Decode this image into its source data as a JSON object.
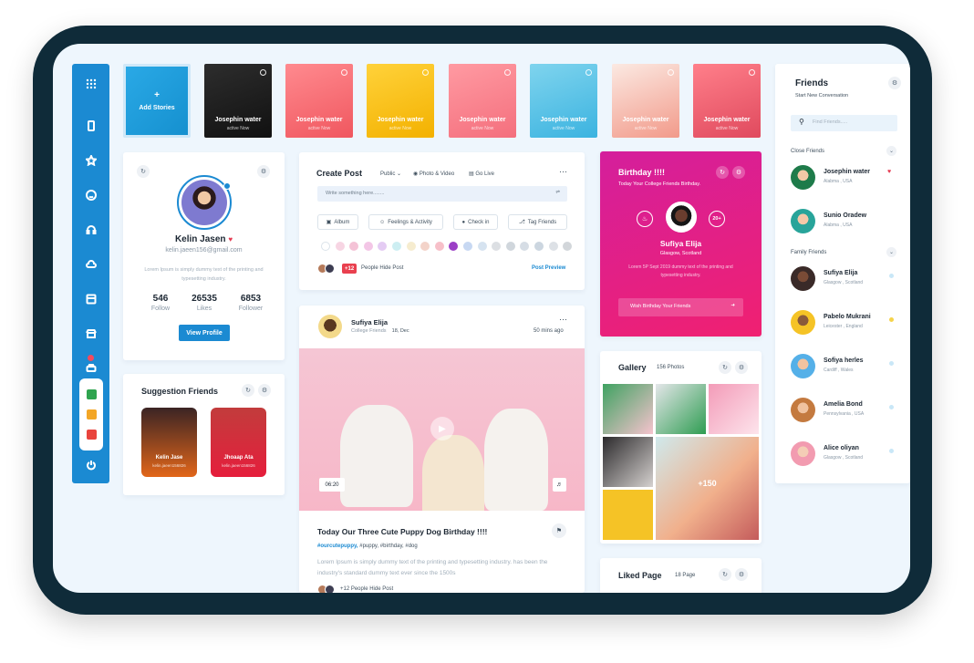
{
  "stories": [
    {
      "label": "Add Stories",
      "sub": "",
      "add": true
    },
    {
      "label": "Josephin water",
      "sub": "active Now",
      "bg": "linear-gradient(160deg,#2d2d2d,#111)"
    },
    {
      "label": "Josephin water",
      "sub": "active Now",
      "bg": "linear-gradient(160deg,#ff8a8f,#f0575f)"
    },
    {
      "label": "Josephin water",
      "sub": "active Now",
      "bg": "linear-gradient(160deg,#ffd23a,#f3b100)"
    },
    {
      "label": "Josephin water",
      "sub": "active Now",
      "bg": "linear-gradient(160deg,#ff9aa2,#f46f7d)"
    },
    {
      "label": "Josephin water",
      "sub": "active Now",
      "bg": "linear-gradient(160deg,#7fd4ee,#3bb3e0)"
    },
    {
      "label": "Josephin water",
      "sub": "active Now",
      "bg": "linear-gradient(160deg,#fbe9e2,#f29a8a)"
    },
    {
      "label": "Josephin water",
      "sub": "active Now",
      "bg": "linear-gradient(160deg,#ff7f8a,#e04a5e)"
    }
  ],
  "profile": {
    "name": "Kelin Jasen",
    "email": "kelin.jaeen156@gmail.com",
    "bio": "Lorem Ipsum is simply dummy text of the printing and typesetting industry.",
    "stats": [
      {
        "value": "546",
        "label": "Follow"
      },
      {
        "value": "26535",
        "label": "Likes"
      },
      {
        "value": "6853",
        "label": "Follower"
      }
    ],
    "button": "View Profile"
  },
  "suggestions": {
    "title": "Suggestion Friends",
    "items": [
      {
        "name": "Kelin Jase",
        "email": "kelin.jaeen156826"
      },
      {
        "name": "Jhoaap Ata",
        "email": "kelin.jaeen156826"
      }
    ]
  },
  "create_post": {
    "title": "Create Post",
    "privacy": "Public",
    "photo_video": "Photo & Video",
    "go_live": "Go Live",
    "placeholder": "Write something here........",
    "chips": [
      "Album",
      "Feelings & Activity",
      "Check in",
      "Tag Friends"
    ],
    "colors": [
      "#ffffff",
      "#f7d5e3",
      "#f4c2d6",
      "#f3c6e6",
      "#e4cbf3",
      "#cdeef2",
      "#f6eccf",
      "#f3d3c9",
      "#f7c0c9",
      "#9b3fc6",
      "#c7d8f2",
      "#d6e3f0",
      "#dcdfe3",
      "#d0d6dc",
      "#d6dde5",
      "#ccd6e0",
      "#dde1e6",
      "#d2d6da"
    ],
    "people_count": "+12",
    "people_text": "People Hide Post",
    "preview": "Post Preview"
  },
  "post": {
    "author": "Sufiya Elija",
    "group": "College Friends",
    "date": "18, Dec",
    "ago": "50 mins ago",
    "duration": "06:20",
    "heading": "Today Our Three Cute Puppy Dog Birthday !!!!",
    "tags_hl": "#ourcutepuppy,",
    "tags": " #puppy, #birthday, #dog",
    "body": "Lorem Ipsum is simply dummy text of the printing and typesetting industry. has been the industry's standard dummy text ever since the 1500s",
    "people": "+12 People Hide Post"
  },
  "birthday": {
    "title": "Birthday !!!!",
    "subtitle": "Today Your College Friends Birthday.",
    "badge": "20+",
    "name": "Sufiya Elija",
    "location": "Glasgow, Scotland",
    "text": "Lorem 5P Sept 2019 dummy text of the printing and typesetting industry.",
    "button": "Wish Birthday Your Friends"
  },
  "gallery": {
    "title": "Gallery",
    "count": "156 Photos",
    "more": "+150"
  },
  "liked": {
    "title": "Liked Page",
    "count": "18 Page"
  },
  "friends": {
    "title": "Friends",
    "subtitle": "Start New Conversation",
    "search_placeholder": "Find Friends.....",
    "close_label": "Close Friends",
    "family_label": "Family Friends",
    "close": [
      {
        "name": "Josephin water",
        "loc": "Alabma , USA",
        "dot": "#e53950",
        "heart": true
      },
      {
        "name": "Sunio Oradew",
        "loc": "Alabma , USA",
        "dot": "",
        "heart": false
      }
    ],
    "family": [
      {
        "name": "Sufiya Elija",
        "loc": "Glasgow , Scotland",
        "dot": "#c9e7f7"
      },
      {
        "name": "Pabelo Mukrani",
        "loc": "Leicester , England",
        "dot": "#f5d34a"
      },
      {
        "name": "Sofiya herles",
        "loc": "Cardiff , Wales",
        "dot": "#c9e7f7"
      },
      {
        "name": "Amelia Bond",
        "loc": "Pennsylvania , USA",
        "dot": "#c9e7f7"
      },
      {
        "name": "Alice oliyan",
        "loc": "Glasgow , Scotland",
        "dot": "#c9e7f7"
      }
    ]
  }
}
